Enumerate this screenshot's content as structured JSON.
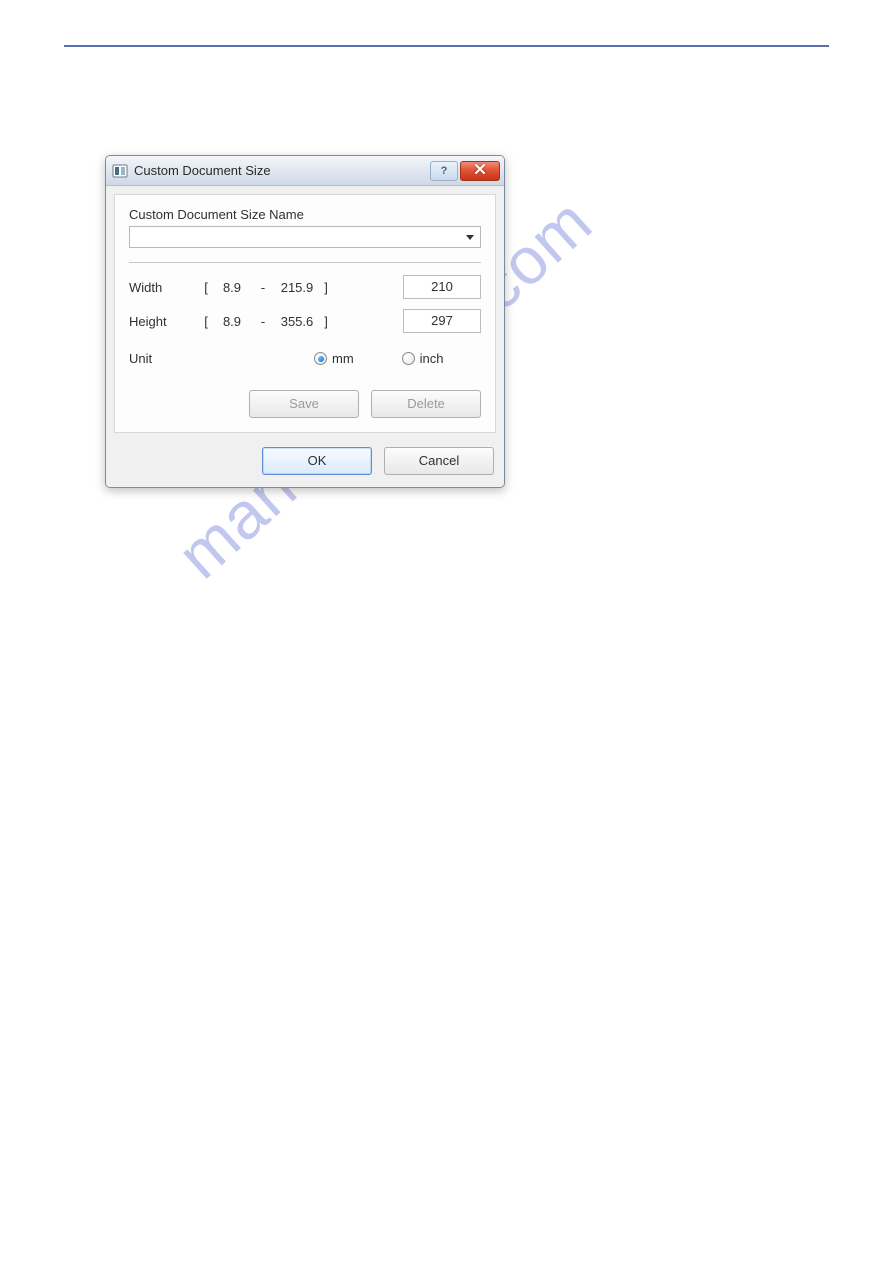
{
  "watermark": "manualshive.com",
  "dialog": {
    "title": "Custom Document Size",
    "help_tooltip": "?",
    "name_label": "Custom Document Size Name",
    "name_value": "",
    "width": {
      "label": "Width",
      "min": "8.9",
      "max": "215.9",
      "value": "210"
    },
    "height": {
      "label": "Height",
      "min": "8.9",
      "max": "355.6",
      "value": "297"
    },
    "unit": {
      "label": "Unit",
      "mm_label": "mm",
      "inch_label": "inch",
      "selected": "mm"
    },
    "buttons": {
      "save": "Save",
      "delete": "Delete",
      "ok": "OK",
      "cancel": "Cancel"
    },
    "range_brackets": {
      "open": "[",
      "close": "]",
      "dash": "-"
    }
  }
}
